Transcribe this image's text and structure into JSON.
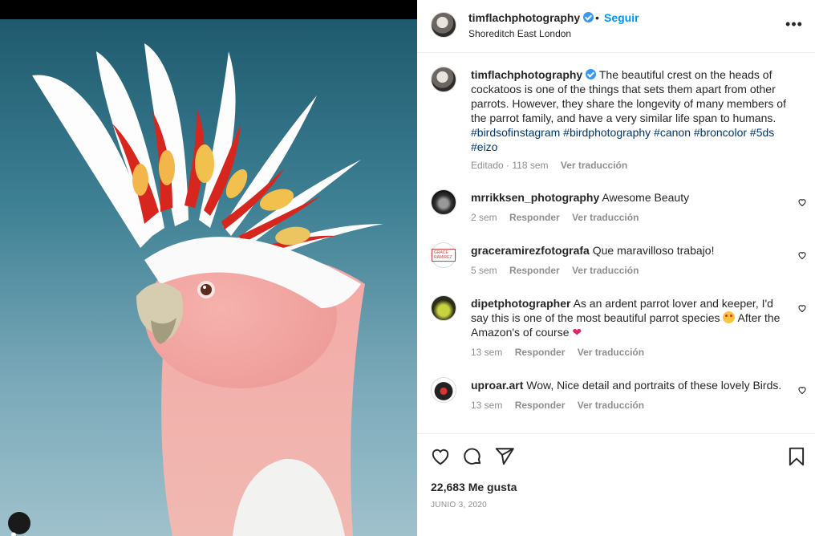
{
  "post": {
    "username": "timflachphotography",
    "verified": true,
    "follow_label": "Seguir",
    "separator": "•",
    "location": "Shoreditch East London",
    "more_icon": "more-horizontal-icon"
  },
  "caption": {
    "username": "timflachphotography",
    "text": "The beautiful crest on the heads of cockatoos is one of the things that sets them apart from other parrots. However, they share the longevity of many members of the parrot family, and have a very similar life span to humans.",
    "hashtags": [
      "#birdsofinstagram",
      "#birdphotography",
      "#canon",
      "#broncolor",
      "#5ds",
      "#eizo"
    ],
    "edited": "Editado",
    "time": "118 sem",
    "translate": "Ver traducción"
  },
  "comments": [
    {
      "username": "mrrikksen_photography",
      "text": "Awesome Beauty",
      "time": "2 sem",
      "reply": "Responder",
      "translate": "Ver traducción"
    },
    {
      "username": "graceramirezfotografa",
      "text": "Que maravilloso trabajo!",
      "time": "5 sem",
      "reply": "Responder",
      "translate": "Ver traducción",
      "avatar_text": "GRACE RAMIREZ"
    },
    {
      "username": "dipetphotographer",
      "text_a": "As an ardent parrot lover and keeper, I'd say this is one of the most beautiful parrot species",
      "text_b": "After the Amazon's of course",
      "time": "13 sem",
      "reply": "Responder",
      "translate": "Ver traducción"
    },
    {
      "username": "uproar.art",
      "text": "Wow, Nice detail and portraits of these lovely Birds.",
      "time": "13 sem",
      "reply": "Responder",
      "translate": "Ver traducción"
    }
  ],
  "stats": {
    "likes": "22,683 Me gusta",
    "date": "JUNIO 3, 2020"
  },
  "colors": {
    "accent": "#0095f6",
    "verified": "#3897f0",
    "muted": "#8e8e8e",
    "hashtag": "#00376b"
  }
}
